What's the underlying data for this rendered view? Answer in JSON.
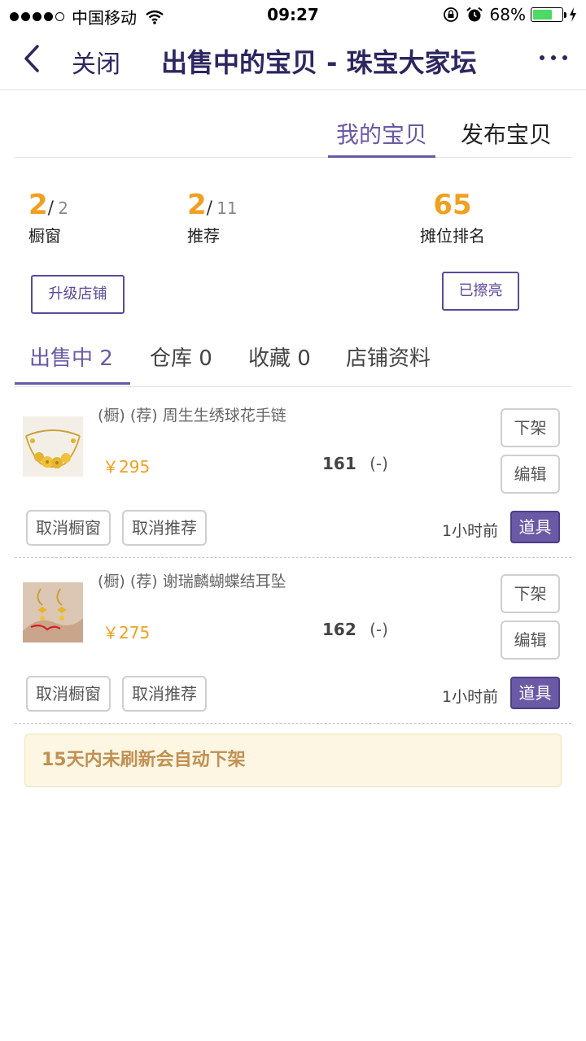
{
  "status_bar": {
    "carrier": "中国移动",
    "time": "09:27",
    "battery_percent_text": "68%",
    "battery_level": 0.68
  },
  "nav": {
    "close_label": "关闭",
    "title": "出售中的宝贝 - 珠宝大家坛"
  },
  "top_tabs": {
    "mine": "我的宝贝",
    "publish": "发布宝贝"
  },
  "stats": {
    "window": {
      "value": "2",
      "slash": "/",
      "total": "2",
      "label": "橱窗"
    },
    "recommend": {
      "value": "2",
      "slash": "/",
      "total": "11",
      "label": "推荐"
    },
    "rank": {
      "value": "65",
      "label": "摊位排名"
    }
  },
  "buttons": {
    "upgrade": "升级店铺",
    "polished": "已擦亮"
  },
  "sub_tabs": [
    {
      "label": "出售中 2"
    },
    {
      "label": "仓库 0"
    },
    {
      "label": "收藏 0"
    },
    {
      "label": "店铺资料"
    }
  ],
  "items": [
    {
      "title": "(橱) (荐) 周生生绣球花手链",
      "price": "￥295",
      "count": "161",
      "count_suffix": "(-)",
      "btn_off_shelf": "下架",
      "btn_edit": "编辑",
      "btn_cancel_window": "取消橱窗",
      "btn_cancel_recommend": "取消推荐",
      "time_ago": "1小时前",
      "btn_prop": "道具"
    },
    {
      "title": "(橱) (荐) 谢瑞麟蝴蝶结耳坠",
      "price": "￥275",
      "count": "162",
      "count_suffix": "(-)",
      "btn_off_shelf": "下架",
      "btn_edit": "编辑",
      "btn_cancel_window": "取消橱窗",
      "btn_cancel_recommend": "取消推荐",
      "time_ago": "1小时前",
      "btn_prop": "道具"
    }
  ],
  "notice": "15天内未刷新会自动下架",
  "colors": {
    "accent": "#6a5aa5",
    "title": "#2c2760",
    "orange": "#f0a020",
    "notice_bg": "#fcf6e3",
    "notice_text": "#c19052"
  }
}
